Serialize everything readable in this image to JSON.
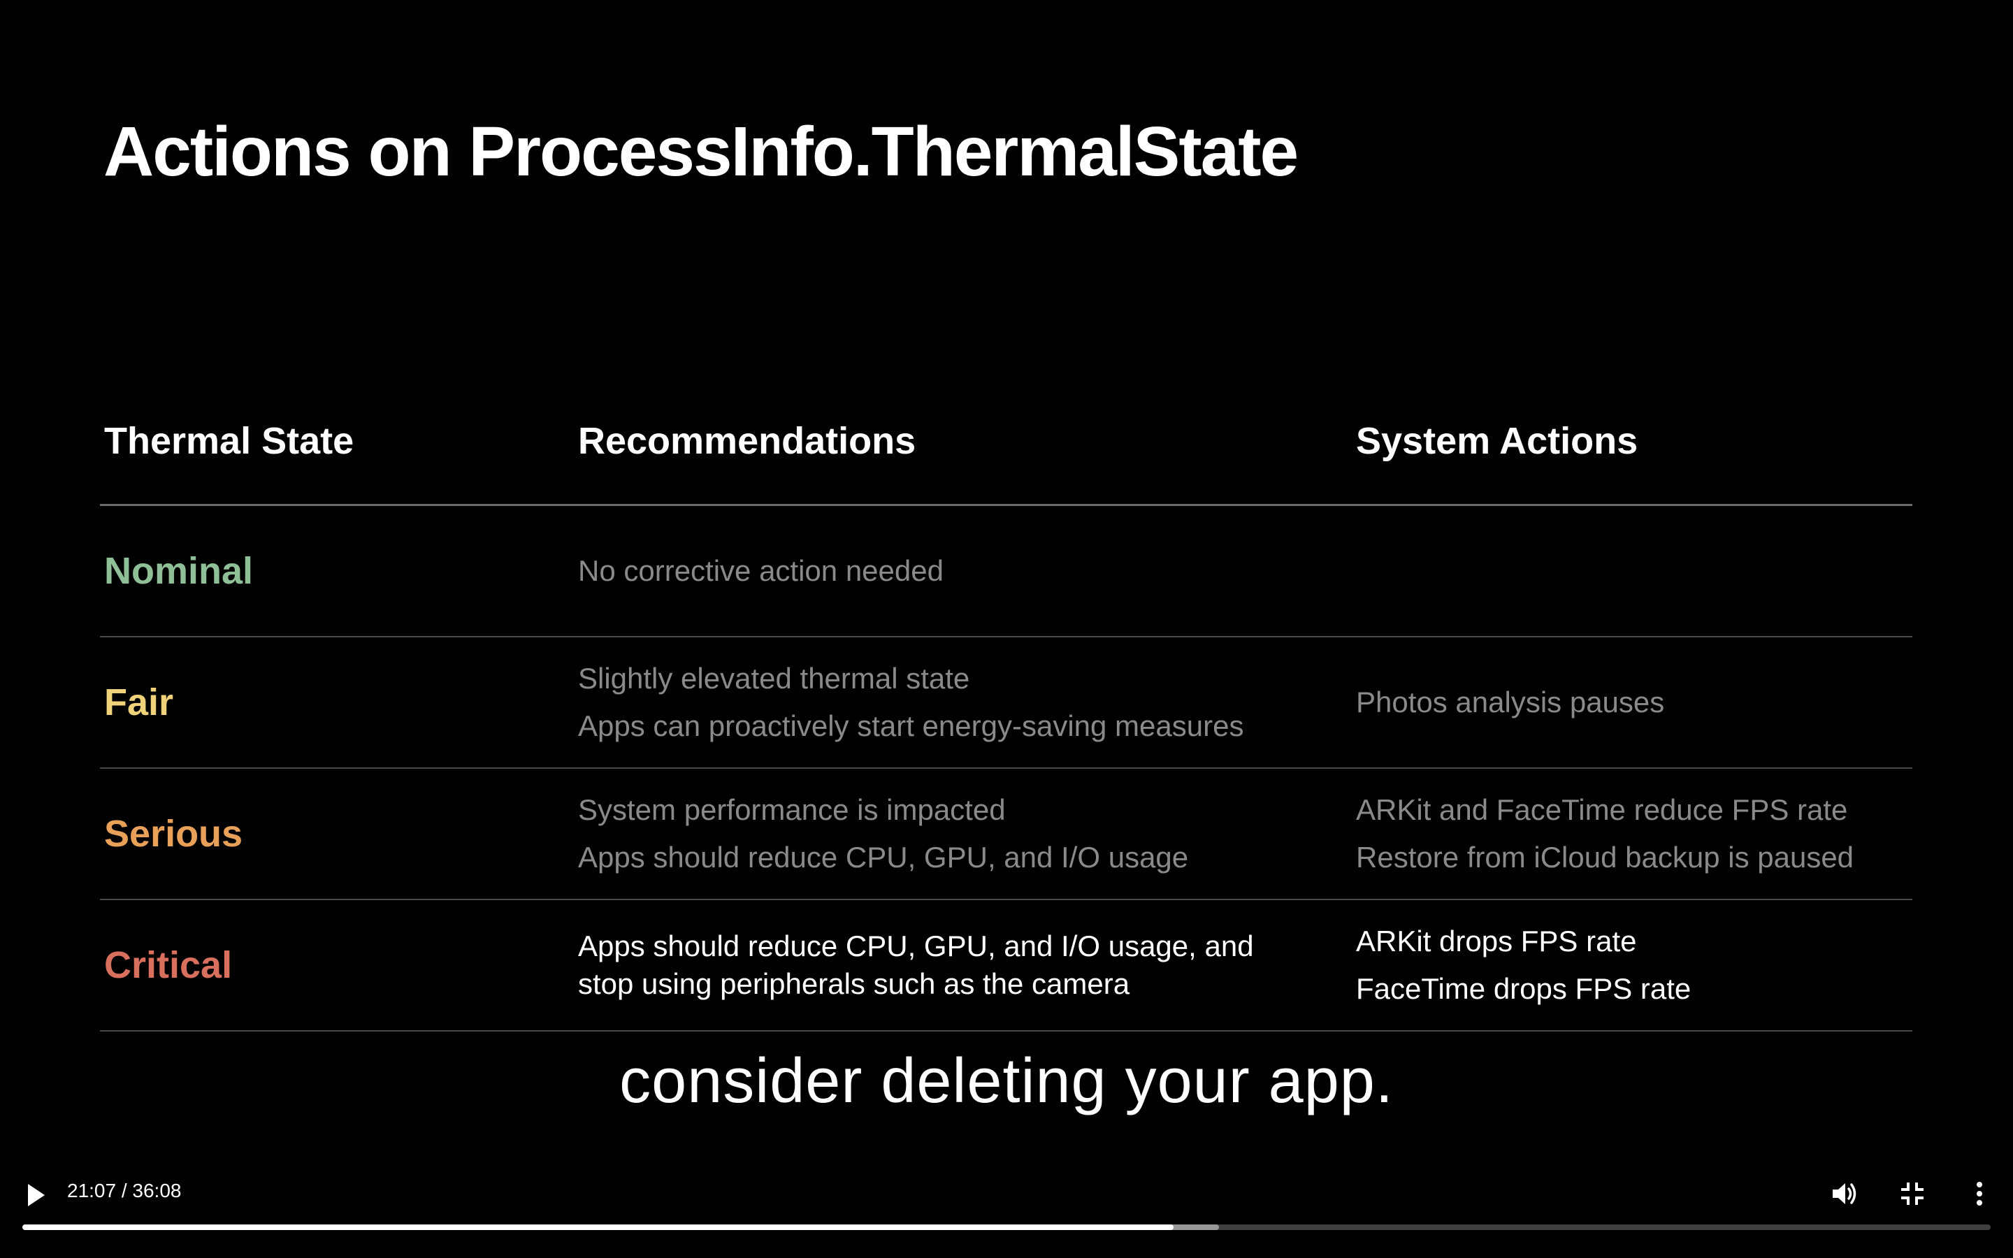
{
  "slide": {
    "title": "Actions on ProcessInfo.ThermalState",
    "headers": {
      "state": "Thermal State",
      "recommendations": "Recommendations",
      "system_actions": "System Actions"
    },
    "rows": [
      {
        "state": "Nominal",
        "state_color": "#8fbf96",
        "recommendations": [
          "No corrective action needed"
        ],
        "system_actions": []
      },
      {
        "state": "Fair",
        "state_color": "#f0d27a",
        "recommendations": [
          "Slightly elevated thermal state",
          "Apps can proactively start energy-saving measures"
        ],
        "system_actions": [
          "Photos analysis pauses"
        ]
      },
      {
        "state": "Serious",
        "state_color": "#e9a15a",
        "recommendations": [
          "System performance is impacted",
          "Apps should reduce CPU, GPU, and I/O usage"
        ],
        "system_actions": [
          "ARKit and FaceTime reduce FPS rate",
          "Restore from iCloud backup is paused"
        ]
      },
      {
        "state": "Critical",
        "state_color": "#d9705e",
        "recommendations": [
          "Apps should reduce CPU, GPU, and I/O usage, and",
          "stop using peripherals such as the camera"
        ],
        "system_actions": [
          "ARKit drops FPS rate",
          "FaceTime drops FPS rate"
        ]
      }
    ]
  },
  "caption": "consider deleting your app.",
  "player": {
    "current_time": "21:07",
    "duration": "36:08",
    "time_label": "21:07 / 36:08",
    "played_fraction": 0.585,
    "buffered_fraction": 0.608,
    "icons": {
      "play": "play-icon",
      "volume": "volume-icon",
      "fullscreen": "exit-fullscreen-icon",
      "more": "more-vertical-icon"
    }
  }
}
